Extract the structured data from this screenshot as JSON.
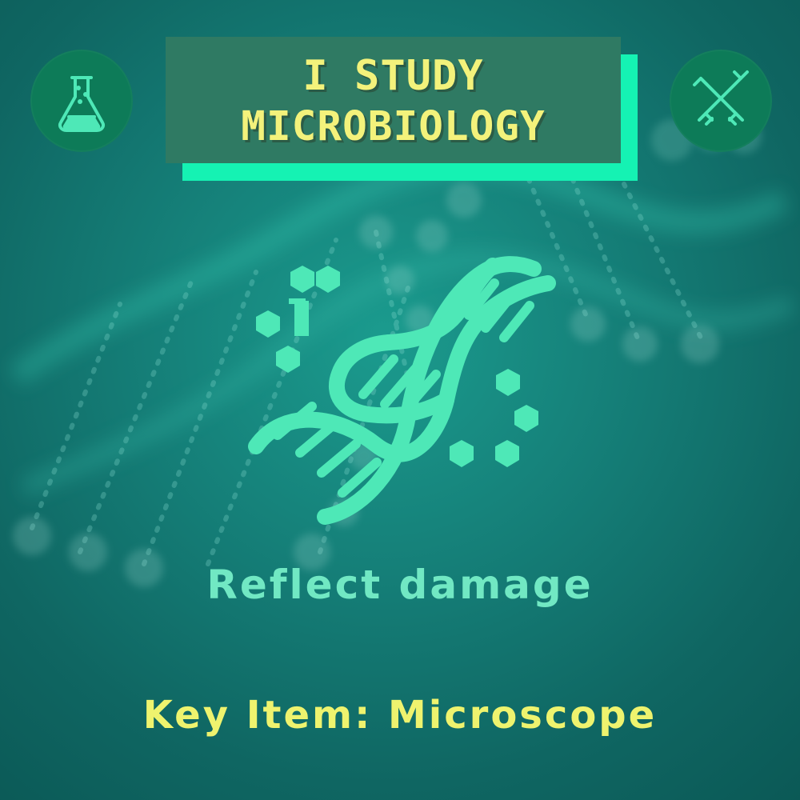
{
  "title": {
    "line1": "I STUDY",
    "line2": "MICROBIOLOGY"
  },
  "effect": "Reflect damage",
  "key_item": "Key Item: Microscope",
  "icons": {
    "left": "flask-icon",
    "right": "crossed-swords-icon",
    "center": "dna-icon"
  },
  "colors": {
    "background": "#157f78",
    "title_box": "#2f7a63",
    "title_accent": "#15f2b3",
    "title_text": "#f3f27b",
    "badge": "#0d7b58",
    "icon_stroke": "#4ee8b7",
    "effect_text": "#71e8c3",
    "key_item_text": "#eef36e"
  }
}
